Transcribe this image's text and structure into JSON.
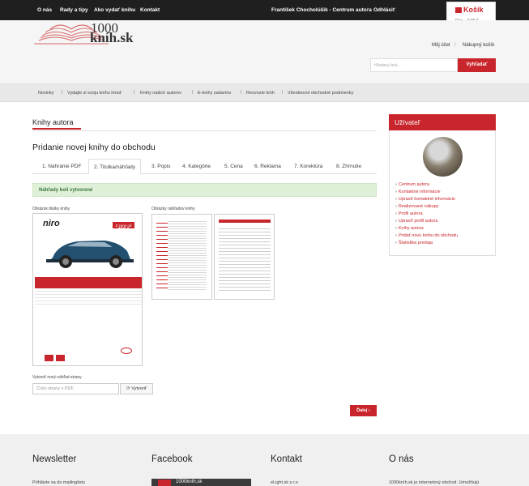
{
  "topbar": {
    "links": [
      "O nás",
      "Rady a tipy",
      "Ako vydať knihu",
      "Kontakt"
    ],
    "user": "František Chocholúšik - Centrum autora",
    "logout": "Odhlásiť"
  },
  "cart": {
    "title": "Košík",
    "subtitle": "0 ks – 0,00 €"
  },
  "header": {
    "logo_number": "1000",
    "logo_text": "kníh.sk",
    "my_account": "Môj účet",
    "shopping_cart": "Nákupný košík",
    "search_placeholder": "Hľadaný text...",
    "search_button": "Vyhľadať"
  },
  "nav": [
    "Novinky",
    "Vydajte si svoju knihu hneď",
    "Knihy našich autorov",
    "E-knihy zadarmo",
    "Recenzie kníh",
    "Všeobecné obchodné podmienky"
  ],
  "main": {
    "section_title": "Knihy autora",
    "heading": "Pridanie novej knihy do obchodu",
    "tabs": [
      "1. Nahranie PDF",
      "2. Titulka/náhľady",
      "3. Popis",
      "4. Kategórie",
      "5. Cena",
      "6. Reklama",
      "7. Korektúra",
      "8. Zhrnutie"
    ],
    "active_tab": 1,
    "alert": "Náhľady boli vytvorené",
    "cover_label": "Obrázok titulky knihy",
    "samples_label": "Obrázky náhľadov knihy",
    "cover_brand": "niro",
    "cover_badge_top": "Z ceny od",
    "cover_badge_price": "400 €",
    "generate_label": "Vytvoriť nový náhľad strany",
    "page_select_placeholder": "Číslo strany v PDF",
    "generate_button": "Vytvoriť",
    "next_button": "Ďalej"
  },
  "user_panel": {
    "title": "Užívateľ",
    "menu": [
      "Centrum autora",
      "Kontaktné informácie",
      "Upraviť kontaktné informácie",
      "Realizované nákupy",
      "Profil autora",
      "Upraviť profil autora",
      "Knihy autora",
      "Pridať novú knihu do obchodu",
      "Štatistika predaja"
    ]
  },
  "footer": {
    "newsletter_title": "Newsletter",
    "newsletter_text": "Prihláste sa do mailinglistu",
    "facebook_title": "Facebook",
    "facebook_text": "1000kníh.sk",
    "contact_title": "Kontakt",
    "contact_text": "eLight.sk s.r.o",
    "about_title": "O nás",
    "about_text": "1000kníh.sk je internetový obchod. Umožňujú"
  }
}
